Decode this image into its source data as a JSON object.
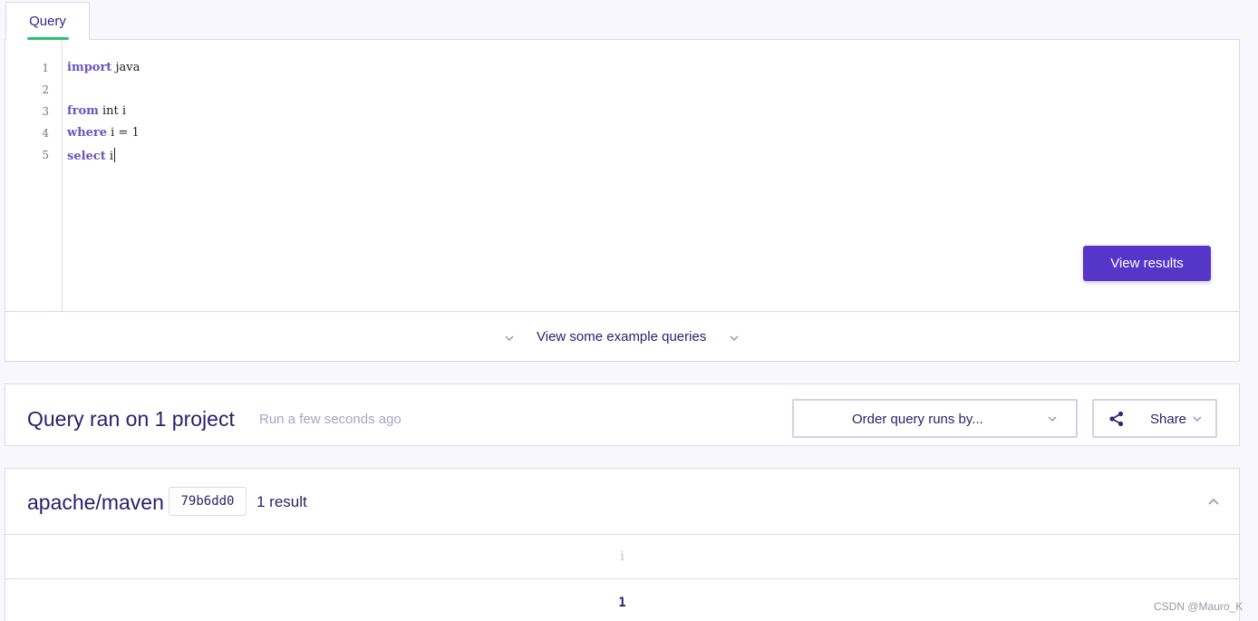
{
  "tab": {
    "label": "Query"
  },
  "editor": {
    "line_numbers": [
      "1",
      "2",
      "3",
      "4",
      "5"
    ],
    "lines": [
      {
        "keyword": "import",
        "rest": " java"
      },
      {
        "keyword": "",
        "rest": ""
      },
      {
        "keyword": "from",
        "rest": " int i"
      },
      {
        "keyword": "where",
        "rest": " i = 1"
      },
      {
        "keyword": "select",
        "rest": " i"
      }
    ],
    "run_button": "View results",
    "examples_link": "View some example queries"
  },
  "run_summary": {
    "title": "Query ran on 1 project",
    "time": "Run a few seconds ago",
    "order_button": "Order query runs by...",
    "share_button": "Share"
  },
  "result": {
    "repo": "apache/maven",
    "commit": "79b6dd0",
    "count": "1 result",
    "columns": [
      "i"
    ],
    "rows": [
      [
        "1"
      ]
    ]
  },
  "watermark": "CSDN @Mauro_K",
  "colors": {
    "accent": "#5536c9",
    "tab_indicator": "#2bbf73",
    "text": "#2a1f6b",
    "keyword": "#6a54c4"
  },
  "icons": [
    "chevron-down-icon",
    "share-icon",
    "chevron-up-icon"
  ]
}
